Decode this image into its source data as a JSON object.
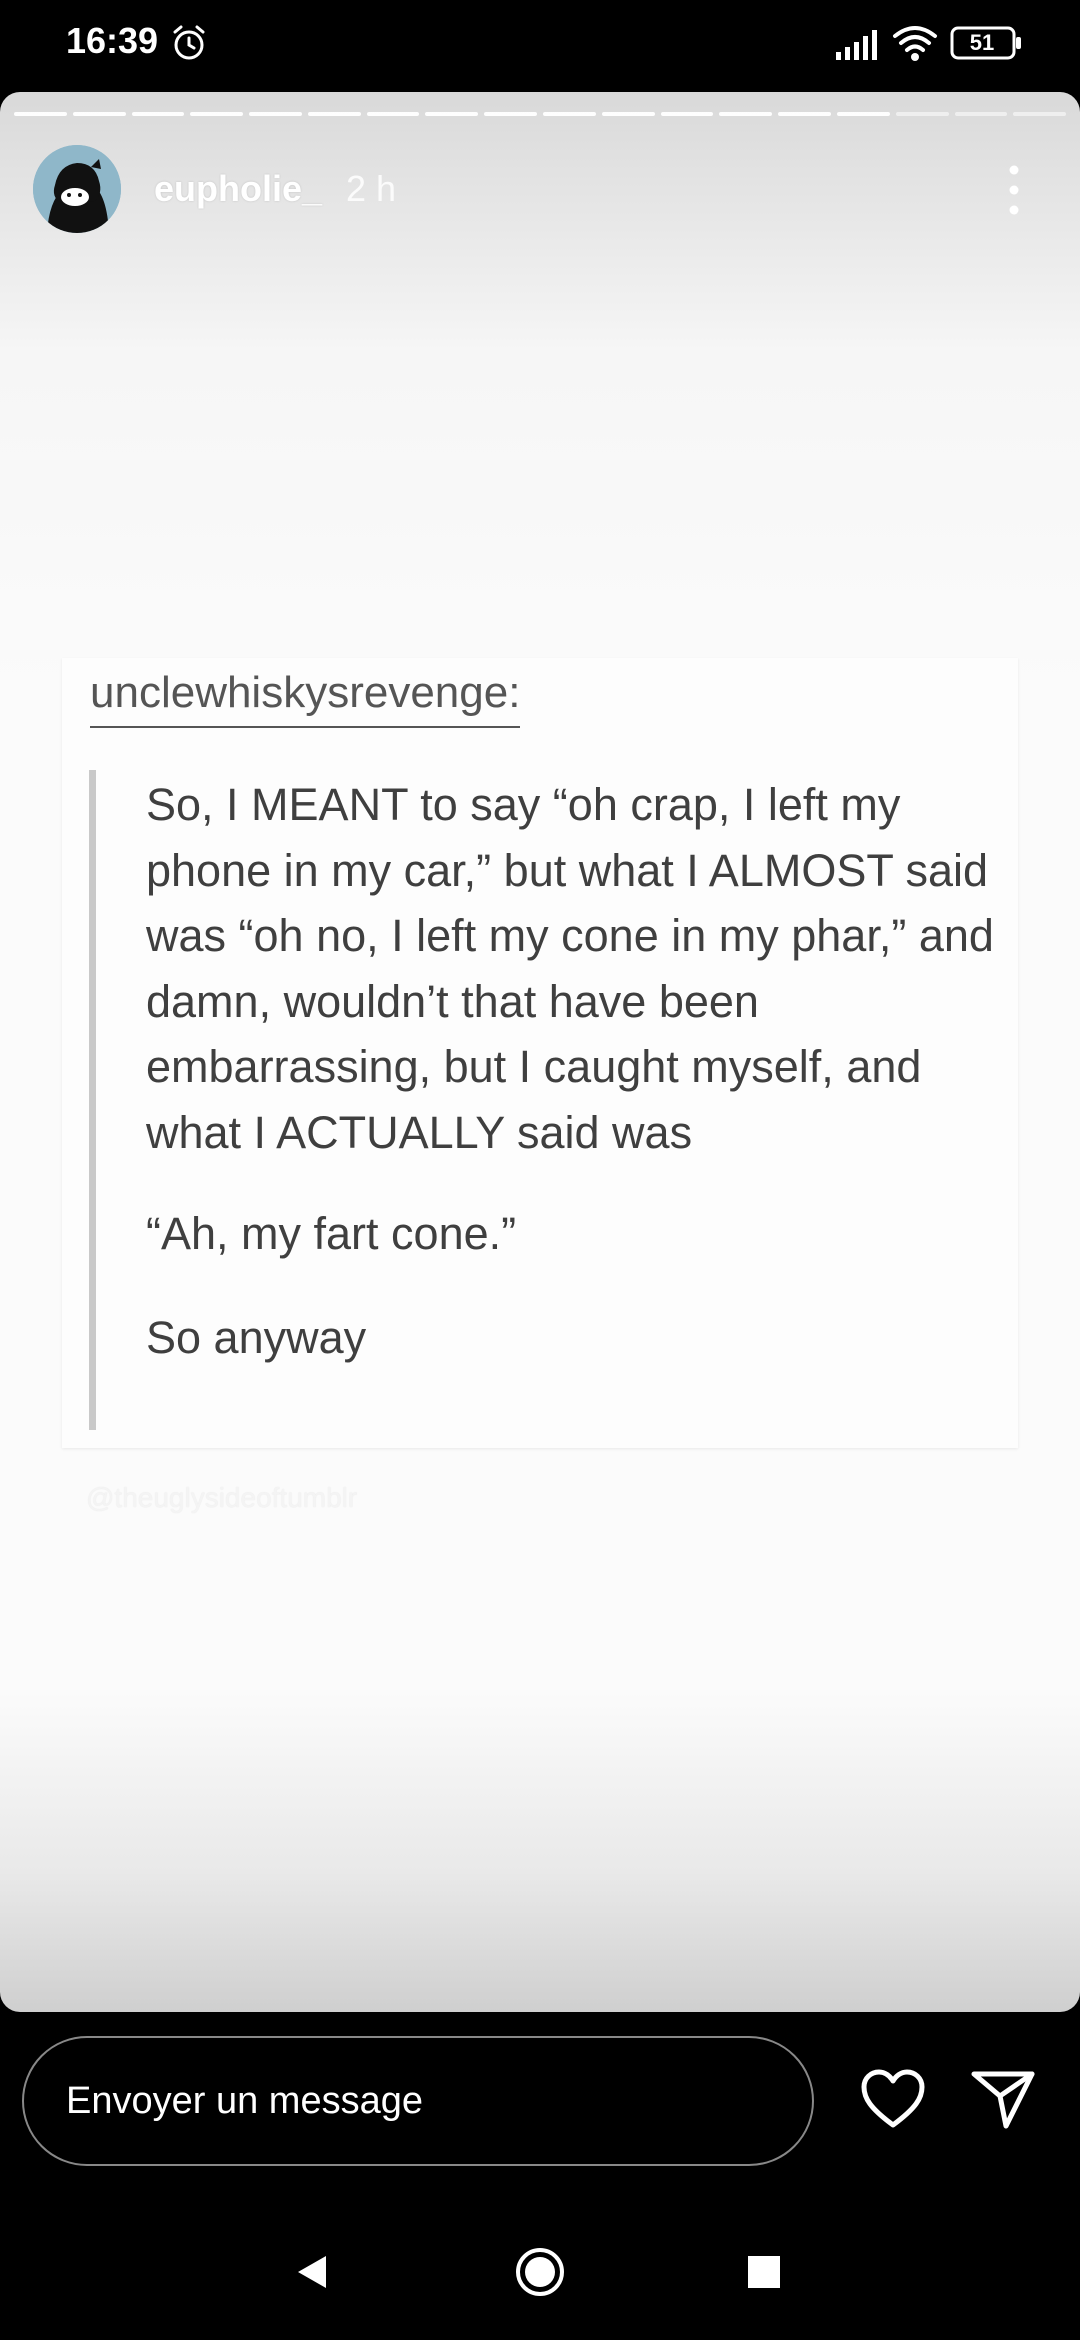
{
  "status_bar": {
    "time": "16:39",
    "battery": "51"
  },
  "story": {
    "username": "eupholie_",
    "time_ago": "2 h",
    "progress_segments_total": 18,
    "progress_segments_viewed": 15
  },
  "post": {
    "author": "unclewhiskysrevenge:",
    "paragraphs": [
      "So, I MEANT to say “oh crap, I left my phone in my car,” but what I ALMOST said was “oh no, I left my cone in my phar,” and damn, wouldn’t that have been embarrassing, but I caught myself, and what I ACTUALLY said was",
      "“Ah, my fart cone.”",
      "So anyway"
    ],
    "watermark": "@theuglysideoftumblr"
  },
  "reply": {
    "placeholder": "Envoyer un message"
  },
  "icons": {
    "alarm": "alarm-icon",
    "signal": "signal-icon",
    "wifi": "wifi-icon",
    "battery": "battery-icon",
    "more": "more-vertical-icon",
    "heart": "heart-icon",
    "send": "send-icon",
    "nav_back": "nav-back-icon",
    "nav_home": "nav-home-icon",
    "nav_recent": "nav-recent-icon"
  },
  "colors": {
    "background": "#000000",
    "story_background": "#fbfbfb",
    "post_text": "#3f3f3f",
    "quote_bar": "#c9c9c9"
  }
}
